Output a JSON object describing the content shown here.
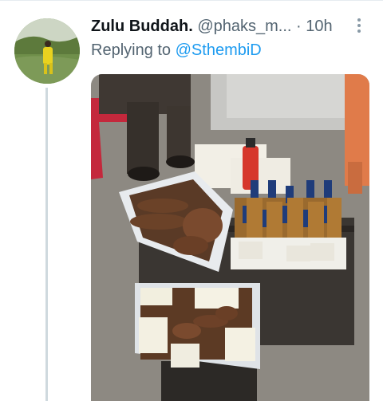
{
  "tweet": {
    "display_name": "Zulu Buddah.",
    "handle": "@phaks_m...",
    "separator": "·",
    "time": "10h",
    "replying_prefix": "Replying to",
    "replying_to": "@SthembiD"
  },
  "icons": {
    "more": "more-vertical-icon"
  },
  "colors": {
    "link": "#1d9bf0",
    "secondary_text": "#536471",
    "thread_line": "#cfd9de"
  }
}
